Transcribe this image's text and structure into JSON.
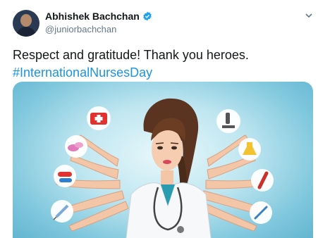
{
  "tweet": {
    "display_name": "Abhishek Bachchan",
    "handle": "@juniorbachchan",
    "verified": true,
    "text_line1": "Respect and gratitude! Thank you heroes.",
    "hashtag": "#InternationalNursesDay"
  },
  "icons": {
    "avatar": "avatar",
    "verified": "verified-badge-icon",
    "menu": "chevron-down-icon"
  },
  "colors": {
    "link": "#1b95e0",
    "verified": "#1da1f2",
    "text": "#14171a",
    "secondary": "#657786"
  },
  "media": {
    "orbs_left": [
      "first-aid-kit-icon",
      "pills-icon",
      "capsules-icon",
      "syringe-icon"
    ],
    "orbs_right": [
      "microscope-icon",
      "flask-icon",
      "test-tube-icon",
      "thermometer-icon"
    ]
  }
}
